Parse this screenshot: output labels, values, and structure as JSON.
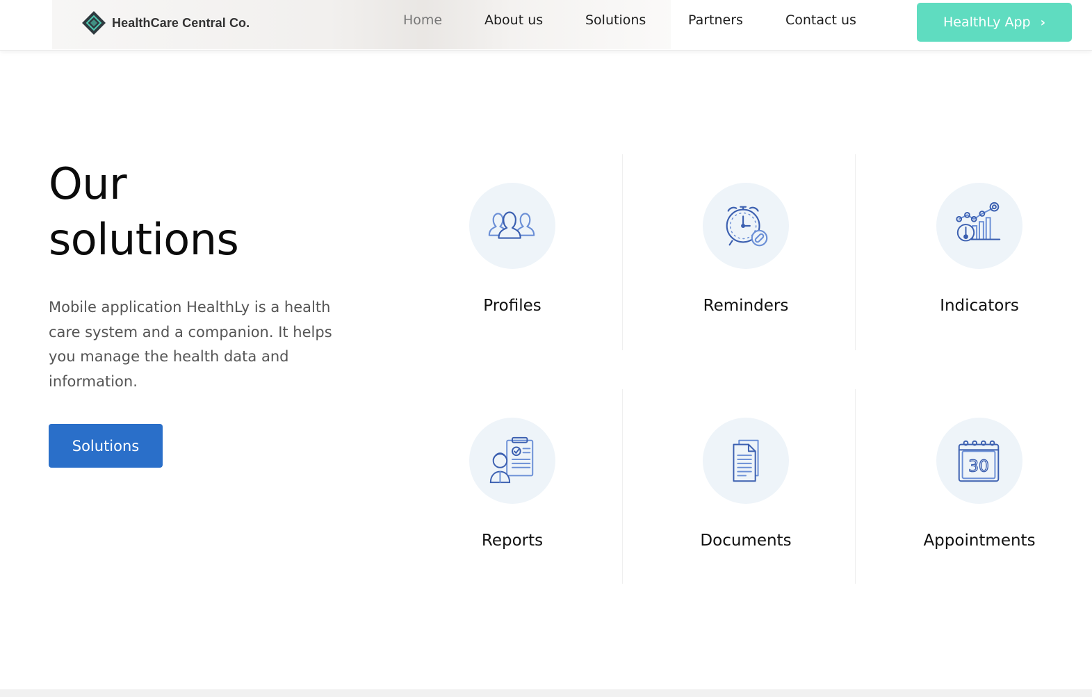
{
  "header": {
    "brand_name": "HealthCare Central Co.",
    "nav": [
      {
        "label": "Home",
        "active": true
      },
      {
        "label": "About us",
        "active": false
      },
      {
        "label": "Solutions",
        "active": false
      },
      {
        "label": "Partners",
        "active": false
      },
      {
        "label": "Contact us",
        "active": false
      }
    ],
    "app_button": {
      "label": "HealthLy App",
      "icon": "chevron-right-icon"
    }
  },
  "hero": {
    "title_line1": "Our",
    "title_line2": "solutions",
    "description": "Mobile application HealthLy is a health care system and a companion. It helps you manage the health data and information.",
    "cta_label": "Solutions"
  },
  "solutions": [
    {
      "label": "Profiles",
      "icon": "users-icon"
    },
    {
      "label": "Reminders",
      "icon": "alarm-clock-icon"
    },
    {
      "label": "Indicators",
      "icon": "indicators-chart-icon"
    },
    {
      "label": "Reports",
      "icon": "report-icon"
    },
    {
      "label": "Documents",
      "icon": "documents-icon"
    },
    {
      "label": "Appointments",
      "icon": "calendar-icon"
    }
  ],
  "colors": {
    "accent_teal": "#5fdcc0",
    "primary_blue": "#2a6fc9",
    "icon_circle_bg": "#eef4f9",
    "icon_stroke": "#3b5fb0"
  }
}
